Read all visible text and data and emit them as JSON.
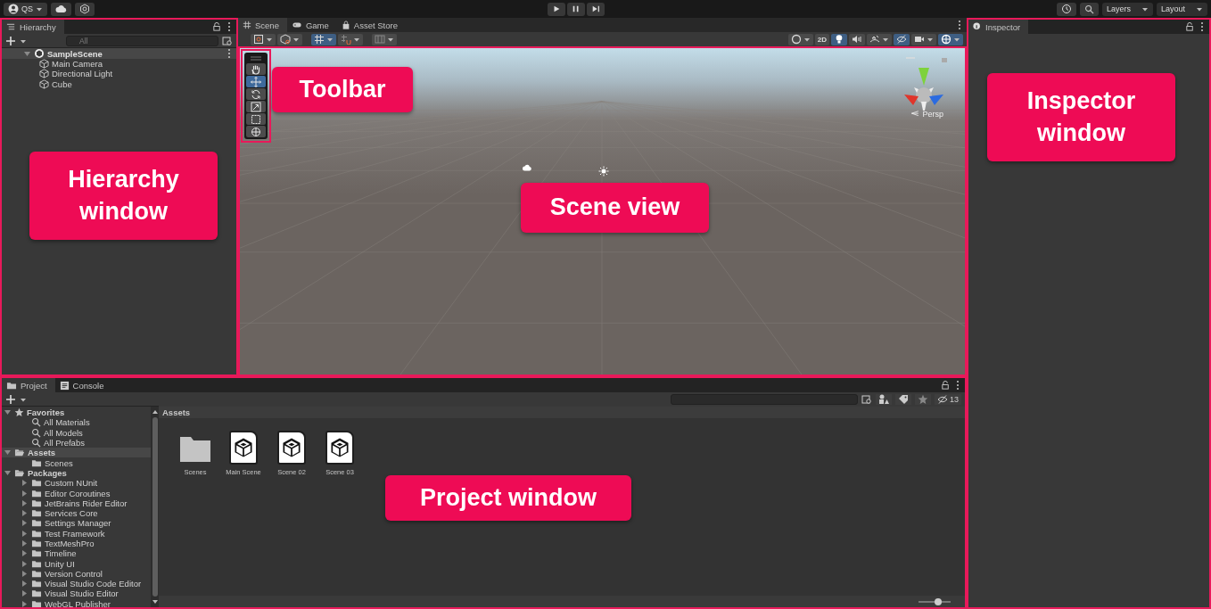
{
  "top_bar": {
    "account": "QS",
    "layers": "Layers",
    "layout": "Layout"
  },
  "hierarchy": {
    "title": "Hierarchy",
    "search_placeholder": "All",
    "scene": "SampleScene",
    "objects": [
      "Main Camera",
      "Directional Light",
      "Cube"
    ]
  },
  "scene_tabs": [
    {
      "label": "Scene",
      "kind": "grid",
      "selected": true
    },
    {
      "label": "Game",
      "kind": "gamepad",
      "selected": false
    },
    {
      "label": "Asset Store",
      "kind": "bag",
      "selected": false
    }
  ],
  "scene_toolbar_left": [
    {
      "kind": "rect-tool",
      "selected": false
    },
    {
      "kind": "pivot",
      "selected": false
    },
    {
      "kind": "grid-snap",
      "selected": true
    },
    {
      "kind": "increment-snap",
      "selected": false
    },
    {
      "kind": "frame",
      "selected": false
    }
  ],
  "scene_toolbar_right": [
    {
      "kind": "shading",
      "selected": false
    },
    {
      "kind": "text",
      "label": "2D",
      "selected": false
    },
    {
      "kind": "light",
      "selected": true
    },
    {
      "kind": "audio",
      "selected": false
    },
    {
      "kind": "effects",
      "selected": false
    },
    {
      "kind": "hidden",
      "selected": true
    },
    {
      "kind": "camera",
      "selected": false
    },
    {
      "kind": "gizmos",
      "selected": true
    }
  ],
  "tools": [
    {
      "kind": "hand",
      "selected": false
    },
    {
      "kind": "move",
      "selected": true
    },
    {
      "kind": "rotate",
      "selected": false
    },
    {
      "kind": "scale",
      "selected": false
    },
    {
      "kind": "rect",
      "selected": false
    },
    {
      "kind": "transform",
      "selected": false
    }
  ],
  "scene_view": {
    "projection": "Persp"
  },
  "inspector": {
    "title": "Inspector"
  },
  "project": {
    "tabs": [
      {
        "label": "Project",
        "kind": "folder",
        "selected": true
      },
      {
        "label": "Console",
        "kind": "console",
        "selected": false
      }
    ],
    "tree": [
      {
        "label": "Favorites",
        "kind": "star",
        "expanded": true,
        "selected": false,
        "children": [
          {
            "label": "All Materials",
            "kind": "search",
            "selected": false
          },
          {
            "label": "All Models",
            "kind": "search",
            "selected": false
          },
          {
            "label": "All Prefabs",
            "kind": "search",
            "selected": false
          }
        ]
      },
      {
        "label": "Assets",
        "kind": "open-folder",
        "expanded": true,
        "selected": true,
        "children": [
          {
            "label": "Scenes",
            "kind": "folder",
            "selected": false
          }
        ]
      },
      {
        "label": "Packages",
        "kind": "open-folder",
        "expanded": true,
        "selected": false,
        "children": [
          {
            "label": "Custom NUnit",
            "kind": "folder",
            "expanded": false,
            "selected": false
          },
          {
            "label": "Editor Coroutines",
            "kind": "folder",
            "expanded": false,
            "selected": false
          },
          {
            "label": "JetBrains Rider Editor",
            "kind": "folder",
            "expanded": false,
            "selected": false
          },
          {
            "label": "Services Core",
            "kind": "folder",
            "expanded": false,
            "selected": false
          },
          {
            "label": "Settings Manager",
            "kind": "folder",
            "expanded": false,
            "selected": false
          },
          {
            "label": "Test Framework",
            "kind": "folder",
            "expanded": false,
            "selected": false
          },
          {
            "label": "TextMeshPro",
            "kind": "folder",
            "expanded": false,
            "selected": false
          },
          {
            "label": "Timeline",
            "kind": "folder",
            "expanded": false,
            "selected": false
          },
          {
            "label": "Unity UI",
            "kind": "folder",
            "expanded": false,
            "selected": false
          },
          {
            "label": "Version Control",
            "kind": "folder",
            "expanded": false,
            "selected": false
          },
          {
            "label": "Visual Studio Code Editor",
            "kind": "folder",
            "expanded": false,
            "selected": false
          },
          {
            "label": "Visual Studio Editor",
            "kind": "folder",
            "expanded": false,
            "selected": false
          },
          {
            "label": "WebGL Publisher",
            "kind": "folder",
            "expanded": false,
            "selected": false
          }
        ]
      }
    ],
    "breadcrumb": "Assets",
    "assets": [
      {
        "kind": "folder",
        "name": "Scenes"
      },
      {
        "kind": "scene",
        "name": "Main Scene"
      },
      {
        "kind": "scene",
        "name": "Scene 02"
      },
      {
        "kind": "scene",
        "name": "Scene 03"
      }
    ],
    "hidden_count": "13",
    "icon_size": {
      "level": 0.6
    }
  },
  "callouts": [
    {
      "label": "Hierarchy window"
    },
    {
      "label": "Toolbar"
    },
    {
      "label": "Scene view"
    },
    {
      "label": "Inspector window"
    },
    {
      "label": "Project window"
    }
  ]
}
